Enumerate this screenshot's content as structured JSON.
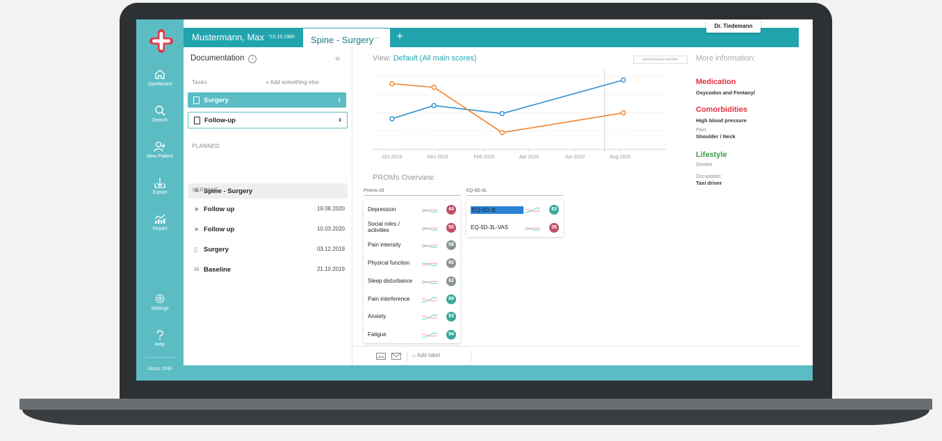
{
  "colors": {
    "teal": "#5bbcc4",
    "teal_dark": "#21a4ae",
    "orange": "#f0822b",
    "blue": "#2f8fd0",
    "red": "#e03040",
    "green": "#3aa14a"
  },
  "user": {
    "doctor": "Dr. Tiedemann"
  },
  "nav": {
    "items": [
      {
        "label": "Dashboard",
        "icon": "home-icon"
      },
      {
        "label": "Search",
        "icon": "search-icon"
      },
      {
        "label": "New Patient",
        "icon": "add-user-icon"
      },
      {
        "label": "Export",
        "icon": "export-icon"
      },
      {
        "label": "Report",
        "icon": "report-icon"
      }
    ],
    "settings": "Settings",
    "help": "Help",
    "about": "About ONE"
  },
  "tabs": {
    "patient_name": "Mustermann, Max",
    "patient_dob": "*10.10.1980",
    "active": "Spine - Surgery",
    "more": "···",
    "add": "+"
  },
  "documentation": {
    "title": "Documentation",
    "tasks_label": "Tasks",
    "add_label": "+ Add something else",
    "tasks": [
      {
        "label": "Surgery"
      },
      {
        "label": "Follow-up"
      }
    ],
    "planned_label": "PLANNED",
    "planned": [
      {
        "label": "Spine - Surgery"
      }
    ],
    "verlauf_label": "VERLAUF",
    "verlauf": [
      {
        "label": "Follow up",
        "date": "19.08.2020",
        "icon": "paper-plane-icon"
      },
      {
        "label": "Follow up",
        "date": "10.03.2020",
        "icon": "paper-plane-icon"
      },
      {
        "label": "Surgery",
        "date": "03.12.2019",
        "icon": "document-icon"
      },
      {
        "label": "Baseline",
        "date": "21.10.2019",
        "icon": "mail-icon"
      }
    ]
  },
  "view": {
    "label": "View:",
    "value": "Default (All main scores)",
    "notification": "NOTIFICATION HISTORY"
  },
  "chart_data": {
    "type": "line",
    "x": [
      "2019-10-15",
      "2019-12-10",
      "2020-03-10",
      "2020-08-19"
    ],
    "xticks": [
      "Oct 2019",
      "Dec 2019",
      "Feb 2020",
      "Apr 2020",
      "Jun 2020",
      "Aug 2020"
    ],
    "series": [
      {
        "values": [
          42,
          60,
          49,
          95
        ],
        "color": "#2f8fd0"
      },
      {
        "values": [
          90,
          85,
          23,
          50
        ],
        "color": "#f0822b"
      }
    ],
    "ylim": [
      0,
      100
    ],
    "grid": true,
    "title": "",
    "xlabel": "",
    "ylabel": ""
  },
  "proms": {
    "title": "PROMs Overview:",
    "promis_label": "Promis-29",
    "promis": [
      {
        "name": "Depression",
        "score": "44",
        "color": "#c0506a"
      },
      {
        "name": "Social roles / activities",
        "score": "50",
        "color": "#c0506a"
      },
      {
        "name": "Pain intensity",
        "score": "59",
        "color": "#8a9590"
      },
      {
        "name": "Physical function",
        "score": "60",
        "color": "#8a9590"
      },
      {
        "name": "Sleep disturbance",
        "score": "62",
        "color": "#8a9590"
      },
      {
        "name": "Pain interference",
        "score": "89",
        "color": "#3aa89a"
      },
      {
        "name": "Anxiety",
        "score": "93",
        "color": "#3aa89a"
      },
      {
        "name": "Fatigue",
        "score": "94",
        "color": "#3aa89a"
      }
    ],
    "eq_label": "EQ-5D-3L",
    "eq": [
      {
        "name": "EQ-5D-3L",
        "score": "83",
        "color": "#3aa89a"
      },
      {
        "name": "EQ-5D-3L-VAS",
        "score": "36",
        "color": "#c0506a"
      }
    ]
  },
  "info": {
    "title": "More information:",
    "medication_title": "Medication",
    "medication": "Oxycodon and Fentanyl",
    "comorbidities_title": "Comorbidities",
    "comorbidities": "High blood pressure",
    "pain_label": "Pain:",
    "pain": "Shoulder / Neck",
    "lifestyle_title": "Lifestyle",
    "lifestyle": "Smoker",
    "occupation_label": "Occupation:",
    "occupation": "Taxi driver"
  },
  "footer": {
    "add_label": "Add label"
  }
}
